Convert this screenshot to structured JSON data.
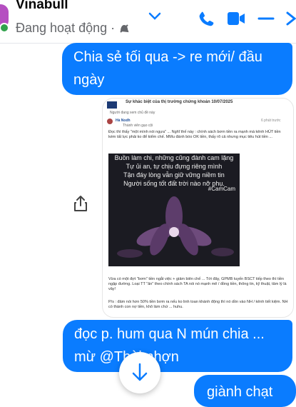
{
  "header": {
    "name": "Vinabull",
    "status": "Đang hoạt động ·",
    "icons": [
      "chevron-down-icon",
      "phone-icon",
      "video-icon",
      "minimize-icon",
      "close-icon"
    ],
    "accent": "#0a7cff"
  },
  "messages": [
    {
      "text": "Chia sẻ tối qua -> re mới/ đầu ngày"
    },
    {
      "text": "đọc p. hum qua N mún chia ... mừ @Thài nhợn"
    },
    {
      "text": "giành chạt"
    }
  ],
  "shared_post": {
    "title": "Sự khác biệt của thị trường chứng khoán 10/07/2025",
    "author": "Hà Nodh",
    "badge": "Thành viên gạo cội",
    "time": "6 phút trước",
    "body": "Đọc thì thấy \"một mình nói ngựa\" ... Nghĩ thế này : chính sách bơm tiền ra mạnh mà kênh HÚT tiền kém tất lực phải ko để kiểm chế. MMu đánh bóo OK tiền, thấy rõ cả nhưng mục tiêu hút tiền ...",
    "quote_lines": [
      "Buồn làm chi, những cũng đành cam lặng",
      "Tự ủi an, tự chịu đựng riêng mình",
      "Tận đáy lòng vẫn giữ vững niềm tin",
      "Người sống tốt đất trời nào nỡ phụ."
    ],
    "hashtag": "#CamCam",
    "bullet": "Vừa có một đợt \"bơm\" tiền ngắt việc + giảm biên chế ... Tới đây, GPMB tuyến BSCT tiếp theo thì tiền ngập đường. Loại TT \"ăn\" theo chính sách TA nói nó mạnh mẽ / đồng tiền, thông tin, kỹ thuật, tâm lý là vây!",
    "ps": "P/s : đảm nói hơn 50% tiền bơm ra nếu ko linh toan khánh động thì nó dồn vào NH / kênh tiết kiệm. NH có thành con nợ tiền, khô làm chứ ... huhu."
  }
}
